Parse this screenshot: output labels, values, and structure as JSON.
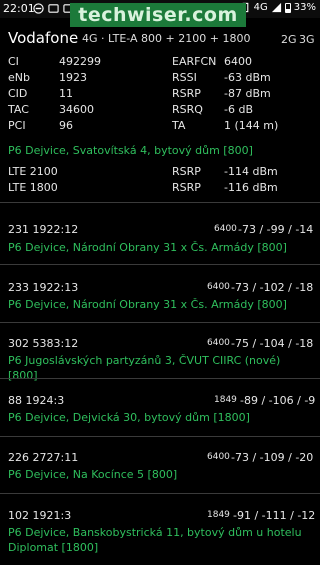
{
  "status_bar": {
    "time": "22:01",
    "network": "4G",
    "battery": "33%"
  },
  "watermark": "techwiser.com",
  "header": {
    "operator": "Vodafone",
    "technology": "4G · LTE-A 800 + 2100 + 1800",
    "mode_2g": "2G",
    "mode_3g": "3G"
  },
  "serving_cell": {
    "ci_label": "CI",
    "ci": "492299",
    "earfcn_label": "EARFCN",
    "earfcn": "6400",
    "enb_label": "eNb",
    "enb": "1923",
    "rssi_label": "RSSI",
    "rssi": "-63 dBm",
    "cid_label": "CID",
    "cid": "11",
    "rsrp_label": "RSRP",
    "rsrp": "-87 dBm",
    "tac_label": "TAC",
    "tac": "34600",
    "rsrq_label": "RSRQ",
    "rsrq": "-6 dB",
    "pci_label": "PCI",
    "pci": "96",
    "ta_label": "TA",
    "ta": "1 (144 m)",
    "location": "P6 Dejvice, Svatovítská 4, bytový dům [800]"
  },
  "carriers": [
    {
      "band": "LTE 2100",
      "label": "RSRP",
      "value": "-114 dBm"
    },
    {
      "band": "LTE 1800",
      "label": "RSRP",
      "value": "-116 dBm"
    }
  ],
  "neighbors": [
    {
      "id": "231  1922:12",
      "earfcn": "6400",
      "signal": "-73 / -99 / -14",
      "location": "P6 Dejvice, Národní Obrany 31 x Čs. Armády [800]"
    },
    {
      "id": "233  1922:13",
      "earfcn": "6400",
      "signal": "-73 / -102 / -18",
      "location": "P6 Dejvice, Národní Obrany 31 x Čs. Armády [800]"
    },
    {
      "id": "302  5383:12",
      "earfcn": "6400",
      "signal": "-75 / -104 / -18",
      "location": "P6 Jugoslávských partyzánů 3, ČVUT CIIRC (nové) [800]"
    },
    {
      "id": "88  1924:3",
      "earfcn": "1849",
      "signal": "-89 / -106 / -9",
      "location": "P6 Dejvice, Dejvická 30, bytový dům [1800]"
    },
    {
      "id": "226  2727:11",
      "earfcn": "6400",
      "signal": "-73 / -109 / -20",
      "location": "P6 Dejvice, Na Kocínce 5 [800]"
    },
    {
      "id": "102  1921:3",
      "earfcn": "1849",
      "signal": "-91 / -111 / -12",
      "location": "P6 Dejvice, Banskobystrická 11, bytový dům u hotelu Diplomat [1800]"
    }
  ]
}
